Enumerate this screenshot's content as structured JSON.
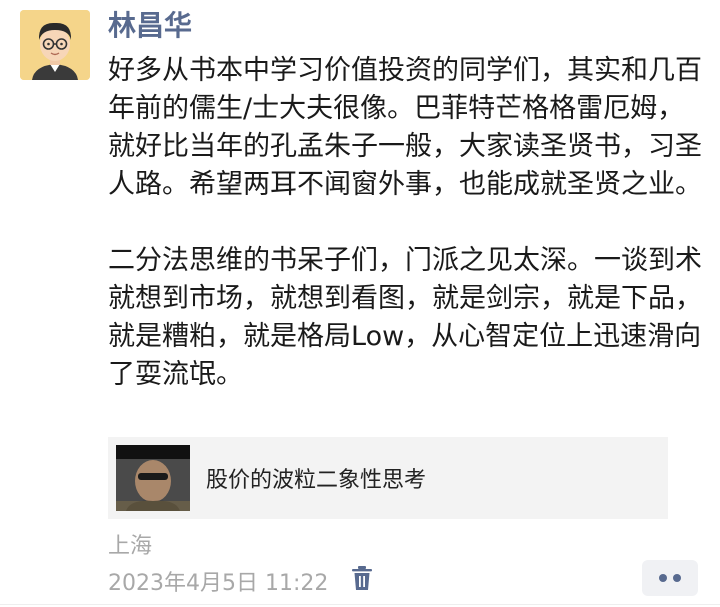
{
  "post": {
    "username": "林昌华",
    "paragraphs": [
      "好多从书本中学习价值投资的同学们，其实和几百年前的儒生/士大夫很像。巴菲特芒格格雷厄姆，就好比当年的孔孟朱子一般，大家读圣贤书，习圣人路。希望两耳不闻窗外事，也能成就圣贤之业。",
      "二分法思维的书呆子们，门派之见太深。一谈到术就想到市场，就想到看图，就是剑宗，就是下品，就是糟粕，就是格局Low，从心智定位上迅速滑向了耍流氓。"
    ],
    "link_card": {
      "title": "股价的波粒二象性思考"
    },
    "location": "上海",
    "timestamp": "2023年4月5日 11:22"
  },
  "icons": {
    "avatar": "cartoon-avatar-icon",
    "delete": "trash-icon",
    "more": "more-dots-icon"
  },
  "colors": {
    "username": "#586a8f",
    "meta": "#a8a8a8",
    "card_bg": "#f3f3f3",
    "avatar_bg": "#f5d58a"
  }
}
